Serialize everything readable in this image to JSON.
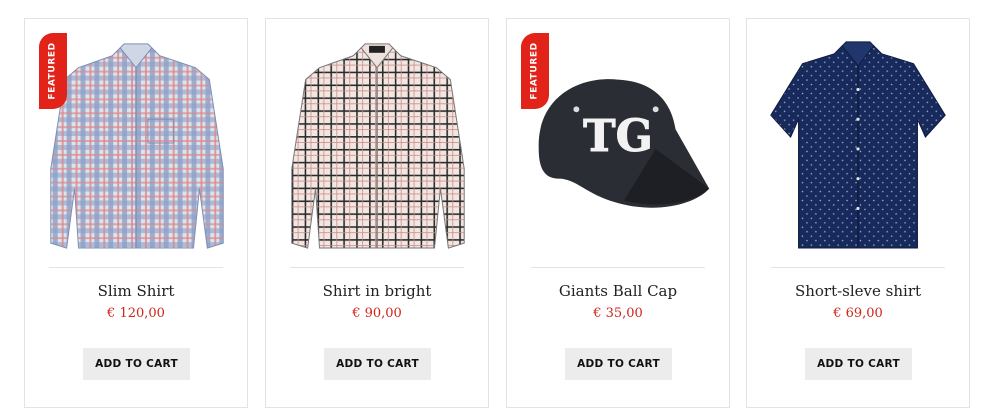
{
  "products": [
    {
      "title": "Slim Shirt",
      "price": "€ 120,00",
      "badge": "FEATURED",
      "cart_label": "ADD TO CART",
      "icon": "plaid-shirt-icon"
    },
    {
      "title": "Shirt in bright",
      "price": "€ 90,00",
      "badge": "",
      "cart_label": "ADD TO CART",
      "icon": "checked-shirt-icon"
    },
    {
      "title": "Giants Ball Cap",
      "price": "€ 35,00",
      "badge": "FEATURED",
      "cart_label": "ADD TO CART",
      "icon": "cap-icon"
    },
    {
      "title": "Short-sleve shirt",
      "price": "€ 69,00",
      "badge": "",
      "cart_label": "ADD TO CART",
      "icon": "short-sleeve-shirt-icon"
    }
  ],
  "colors": {
    "accent": "#e2231a",
    "price": "#d0251b",
    "button_bg": "#ececec",
    "border": "#e3e3e3"
  }
}
